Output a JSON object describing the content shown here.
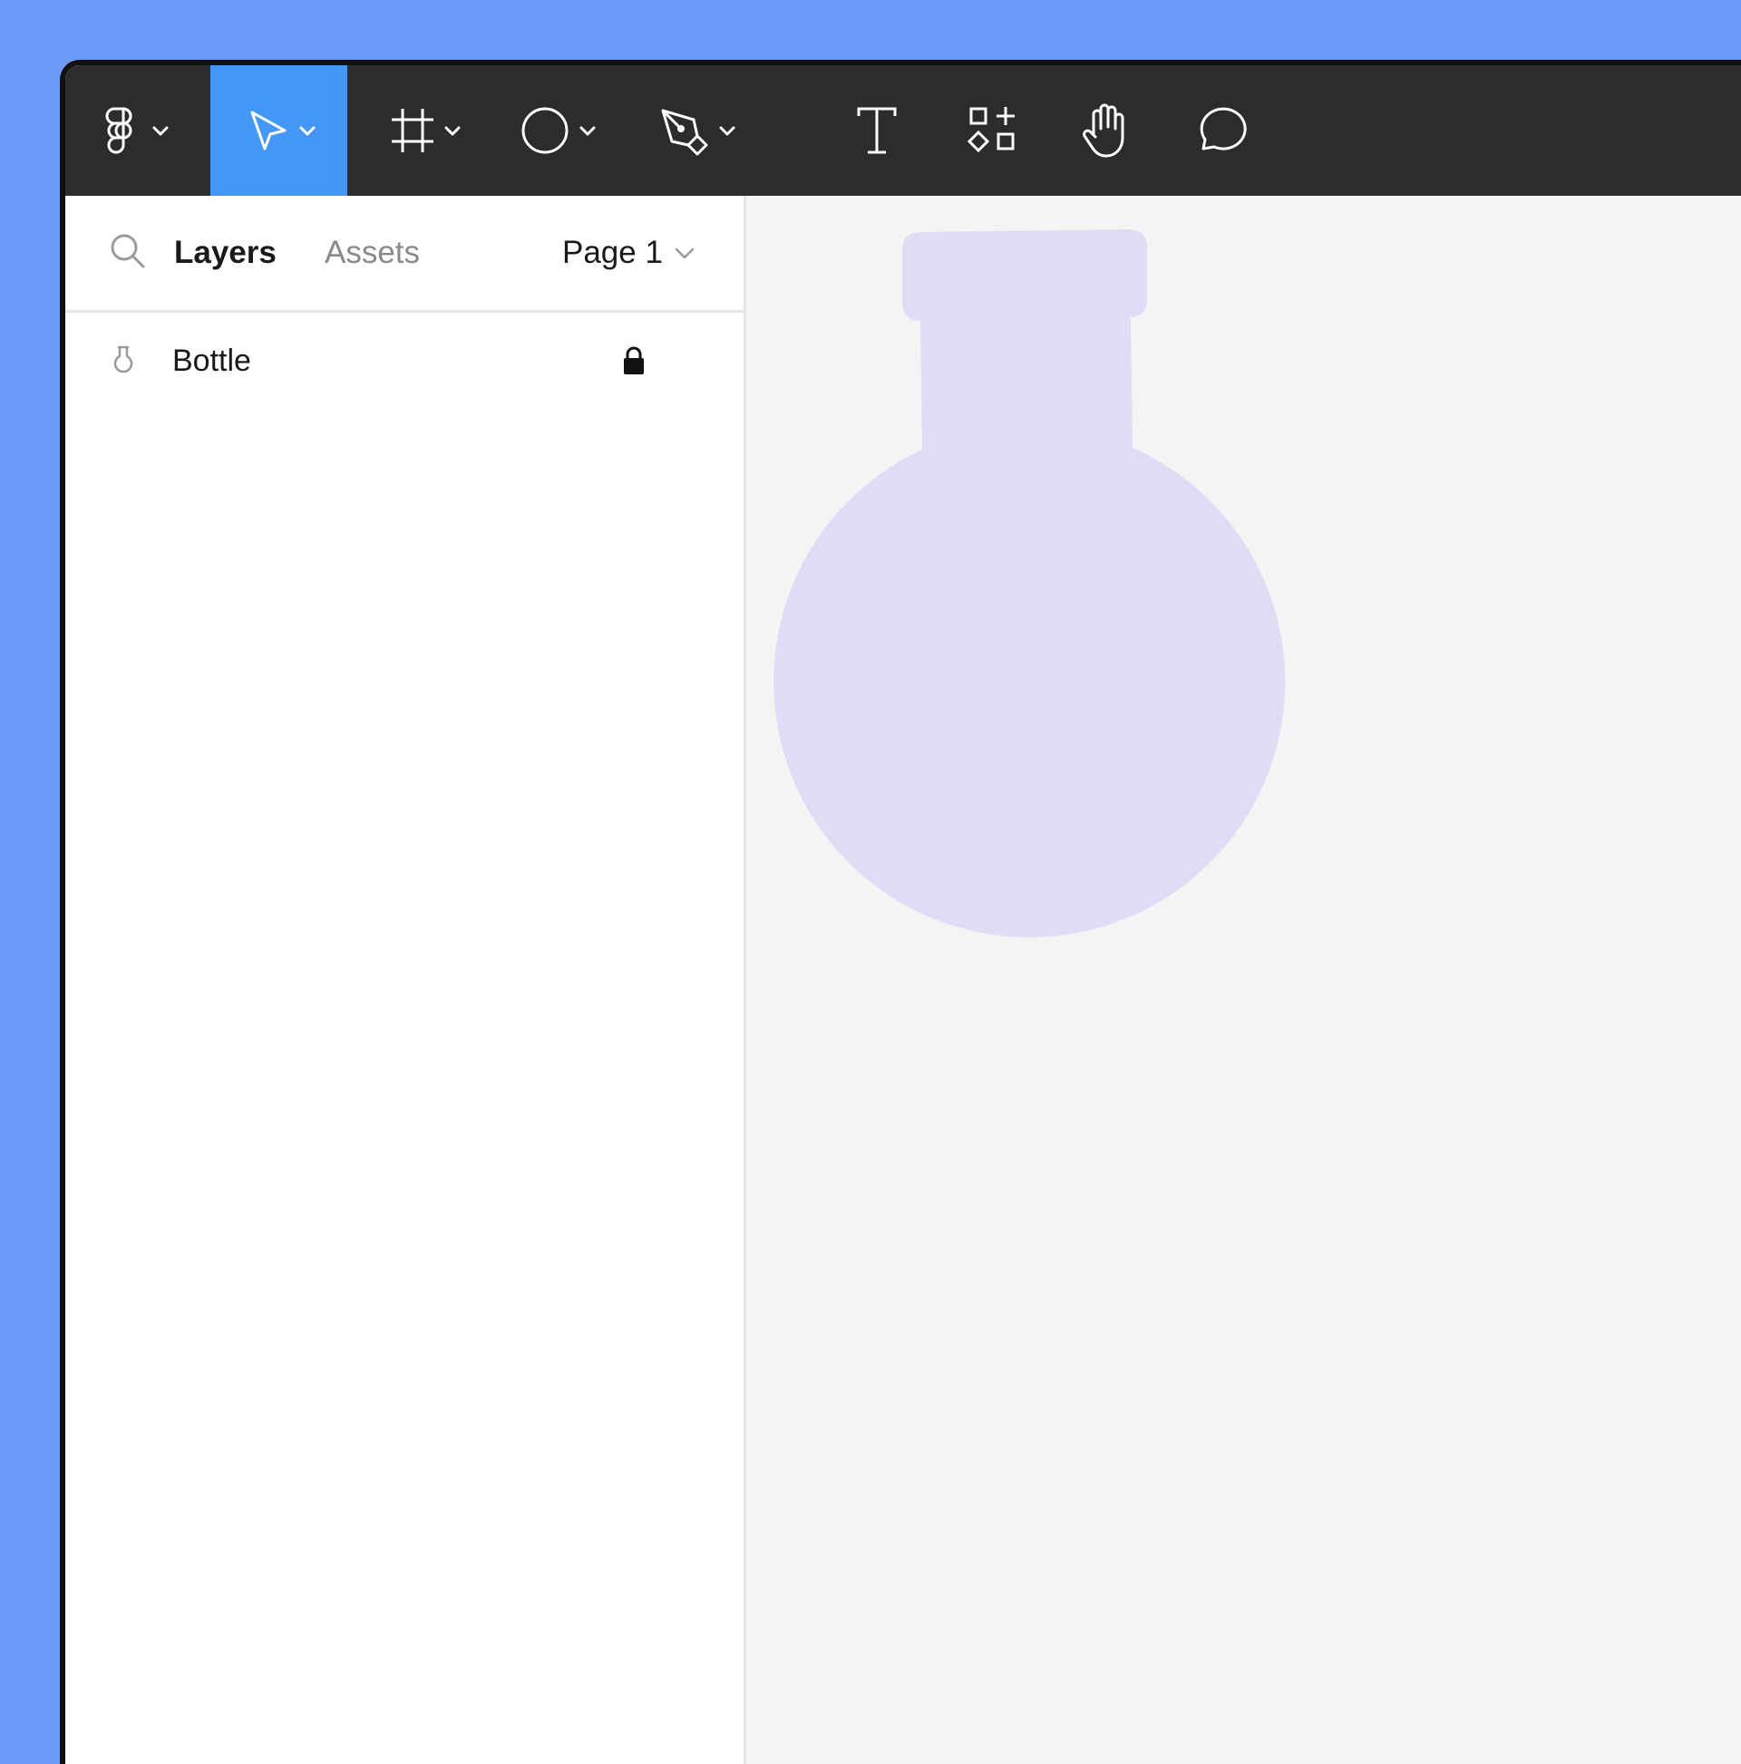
{
  "toolbar": {
    "tools": [
      {
        "name": "figma-menu",
        "icon": "figma-logo-icon",
        "has_dropdown": true
      },
      {
        "name": "move",
        "icon": "cursor-arrow-icon",
        "has_dropdown": true,
        "active": true
      },
      {
        "name": "frame",
        "icon": "frame-hash-icon",
        "has_dropdown": true
      },
      {
        "name": "shape",
        "icon": "ellipse-icon",
        "has_dropdown": true
      },
      {
        "name": "pen",
        "icon": "pen-nib-icon",
        "has_dropdown": true
      },
      {
        "name": "text",
        "icon": "text-t-icon",
        "has_dropdown": false
      },
      {
        "name": "resources",
        "icon": "components-icon",
        "has_dropdown": false
      },
      {
        "name": "hand",
        "icon": "hand-icon",
        "has_dropdown": false
      },
      {
        "name": "comment",
        "icon": "speech-bubble-icon",
        "has_dropdown": false
      }
    ],
    "active_color": "#4597f7",
    "background": "#2c2c2c"
  },
  "panel": {
    "tabs": {
      "layers": "Layers",
      "assets": "Assets"
    },
    "page_selector": "Page 1",
    "layers": [
      {
        "name": "Bottle",
        "icon": "bottle-icon",
        "locked": true
      }
    ]
  },
  "canvas": {
    "shape_fill": "#dfdcf6",
    "background": "#f4f4f4"
  },
  "colors": {
    "desktop_background": "#6b9bf7"
  }
}
